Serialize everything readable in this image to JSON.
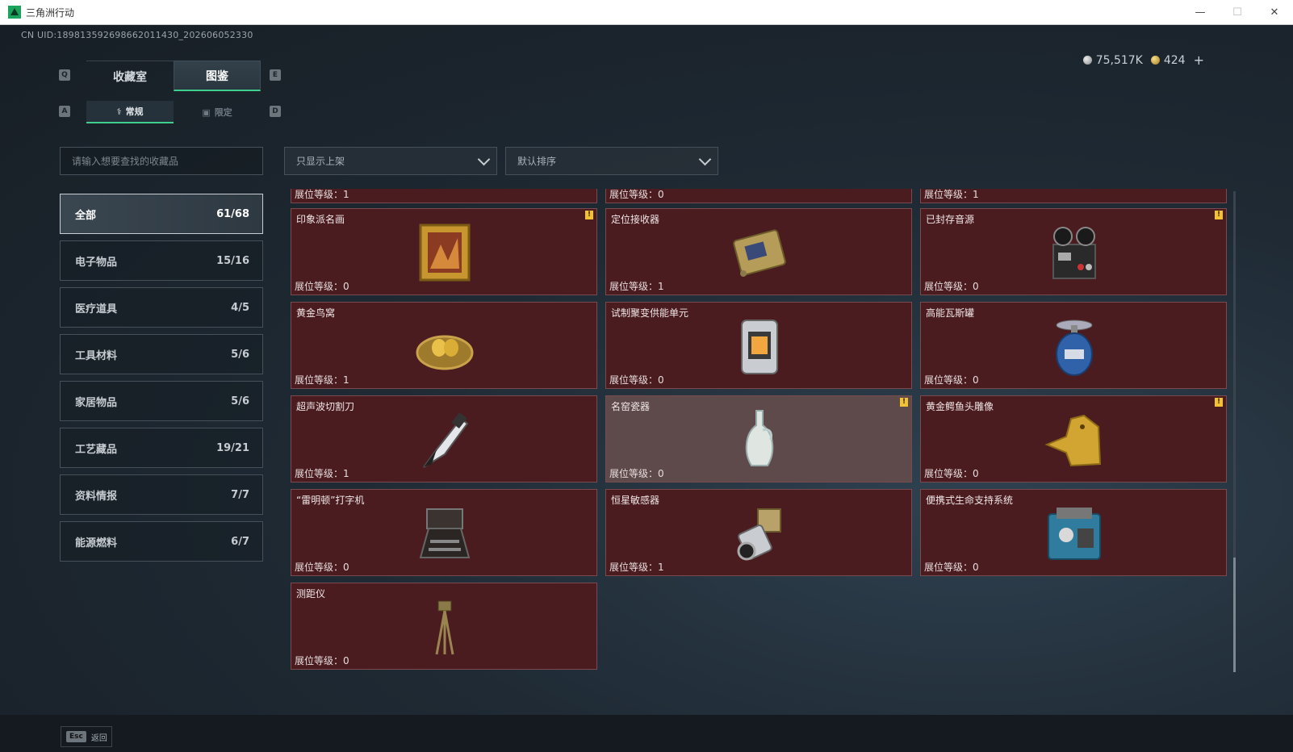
{
  "window": {
    "title": "三角洲行动",
    "minimize": "—",
    "maximize": "☐",
    "close": "✕"
  },
  "uid": "CN UID:1898135926986620114​30_202606052330",
  "currency": {
    "silver": "75,517K",
    "gold": "424",
    "plus": "+"
  },
  "keys": {
    "q": "Q",
    "e": "E",
    "a": "A",
    "d": "D"
  },
  "tabs": [
    {
      "label": "收藏室"
    },
    {
      "label": "图鉴"
    }
  ],
  "subtabs": [
    {
      "label": "常规"
    },
    {
      "label": "限定"
    }
  ],
  "search": {
    "placeholder": "请输入想要查找的收藏品"
  },
  "filters": {
    "shelf": "只显示上架",
    "sort": "默认排序"
  },
  "categories": [
    {
      "label": "全部",
      "count": "61/68"
    },
    {
      "label": "电子物品",
      "count": "15/16"
    },
    {
      "label": "医疗道具",
      "count": "4/5"
    },
    {
      "label": "工具材料",
      "count": "5/6"
    },
    {
      "label": "家居物品",
      "count": "5/6"
    },
    {
      "label": "工艺藏品",
      "count": "19/21"
    },
    {
      "label": "资料情报",
      "count": "7/7"
    },
    {
      "label": "能源燃料",
      "count": "6/7"
    }
  ],
  "items": [
    {
      "name": "",
      "level": "展位等级：1",
      "warn": false
    },
    {
      "name": "",
      "level": "展位等级：0",
      "warn": false
    },
    {
      "name": "",
      "level": "展位等级：1",
      "warn": false
    },
    {
      "name": "印象派名画",
      "level": "展位等级：0",
      "warn": true,
      "icon": "painting-icon"
    },
    {
      "name": "定位接收器",
      "level": "展位等级：1",
      "warn": false,
      "icon": "receiver-icon"
    },
    {
      "name": "已封存音源",
      "level": "展位等级：0",
      "warn": true,
      "icon": "tape-recorder-icon"
    },
    {
      "name": "黄金鸟窝",
      "level": "展位等级：1",
      "warn": false,
      "icon": "golden-nest-icon"
    },
    {
      "name": "试制聚变供能单元",
      "level": "展位等级：0",
      "warn": false,
      "icon": "fusion-cell-icon"
    },
    {
      "name": "高能瓦斯罐",
      "level": "展位等级：0",
      "warn": false,
      "icon": "gas-canister-icon"
    },
    {
      "name": "超声波切割刀",
      "level": "展位等级：1",
      "warn": false,
      "icon": "cutter-icon"
    },
    {
      "name": "名窑瓷器",
      "level": "展位等级：0",
      "warn": true,
      "icon": "porcelain-vase-icon"
    },
    {
      "name": "黄金鳄鱼头雕像",
      "level": "展位等级：0",
      "warn": true,
      "icon": "gold-crocodile-icon"
    },
    {
      "name": "“雷明顿”打字机",
      "level": "展位等级：0",
      "warn": false,
      "icon": "typewriter-icon"
    },
    {
      "name": "恒星敏感器",
      "level": "展位等级：1",
      "warn": false,
      "icon": "star-sensor-icon"
    },
    {
      "name": "便携式生命支持系统",
      "level": "展位等级：0",
      "warn": false,
      "icon": "life-support-icon"
    },
    {
      "name": "测距仪",
      "level": "展位等级：0",
      "warn": false,
      "icon": "rangefinder-icon"
    }
  ],
  "footer": {
    "key": "Esc",
    "label": "返回"
  }
}
